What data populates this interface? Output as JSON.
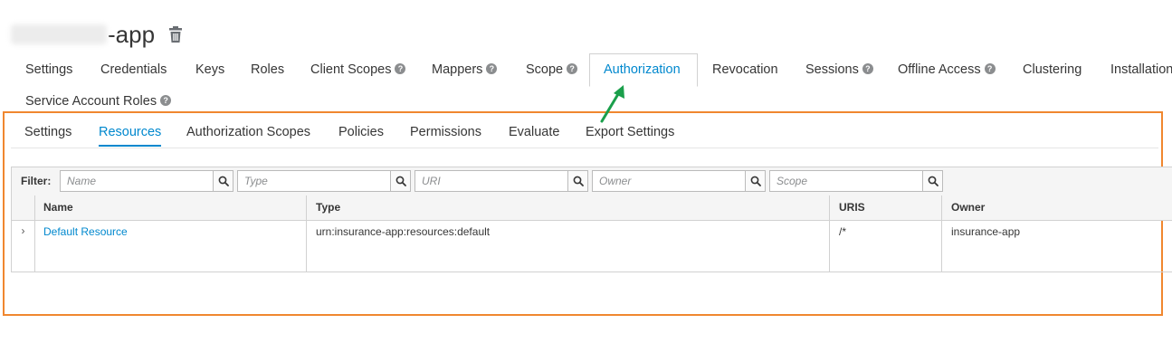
{
  "header": {
    "title_suffix": "-app"
  },
  "client_tabs": [
    {
      "label": "Settings"
    },
    {
      "label": "Credentials"
    },
    {
      "label": "Keys"
    },
    {
      "label": "Roles"
    },
    {
      "label": "Client Scopes",
      "help": true
    },
    {
      "label": "Mappers",
      "help": true
    },
    {
      "label": "Scope",
      "help": true
    },
    {
      "label": "Authorization",
      "active": true
    },
    {
      "label": "Revocation"
    },
    {
      "label": "Sessions",
      "help": true
    },
    {
      "label": "Offline Access",
      "help": true
    },
    {
      "label": "Clustering"
    },
    {
      "label": "Installation"
    },
    {
      "label": "Service Account Roles",
      "help": true
    }
  ],
  "auth_tabs": [
    {
      "label": "Settings"
    },
    {
      "label": "Resources",
      "active": true
    },
    {
      "label": "Authorization Scopes"
    },
    {
      "label": "Policies"
    },
    {
      "label": "Permissions"
    },
    {
      "label": "Evaluate"
    },
    {
      "label": "Export Settings"
    }
  ],
  "filter": {
    "label": "Filter:",
    "placeholders": {
      "name": "Name",
      "type": "Type",
      "uri": "URI",
      "owner": "Owner",
      "scope": "Scope"
    }
  },
  "table": {
    "headers": {
      "name": "Name",
      "type": "Type",
      "uris": "URIS",
      "owner": "Owner"
    },
    "rows": [
      {
        "name": "Default Resource",
        "type": "urn:insurance-app:resources:default",
        "uris": "/*",
        "owner": "insurance-app"
      }
    ]
  },
  "colors": {
    "accent": "#0088ce",
    "annotation_box": "#f0872f",
    "annotation_arrow": "#1a9f4b"
  },
  "icons": {
    "delete": "trash-icon",
    "help": "question-circle-icon",
    "search": "search-icon",
    "expand": "chevron-right-icon"
  }
}
